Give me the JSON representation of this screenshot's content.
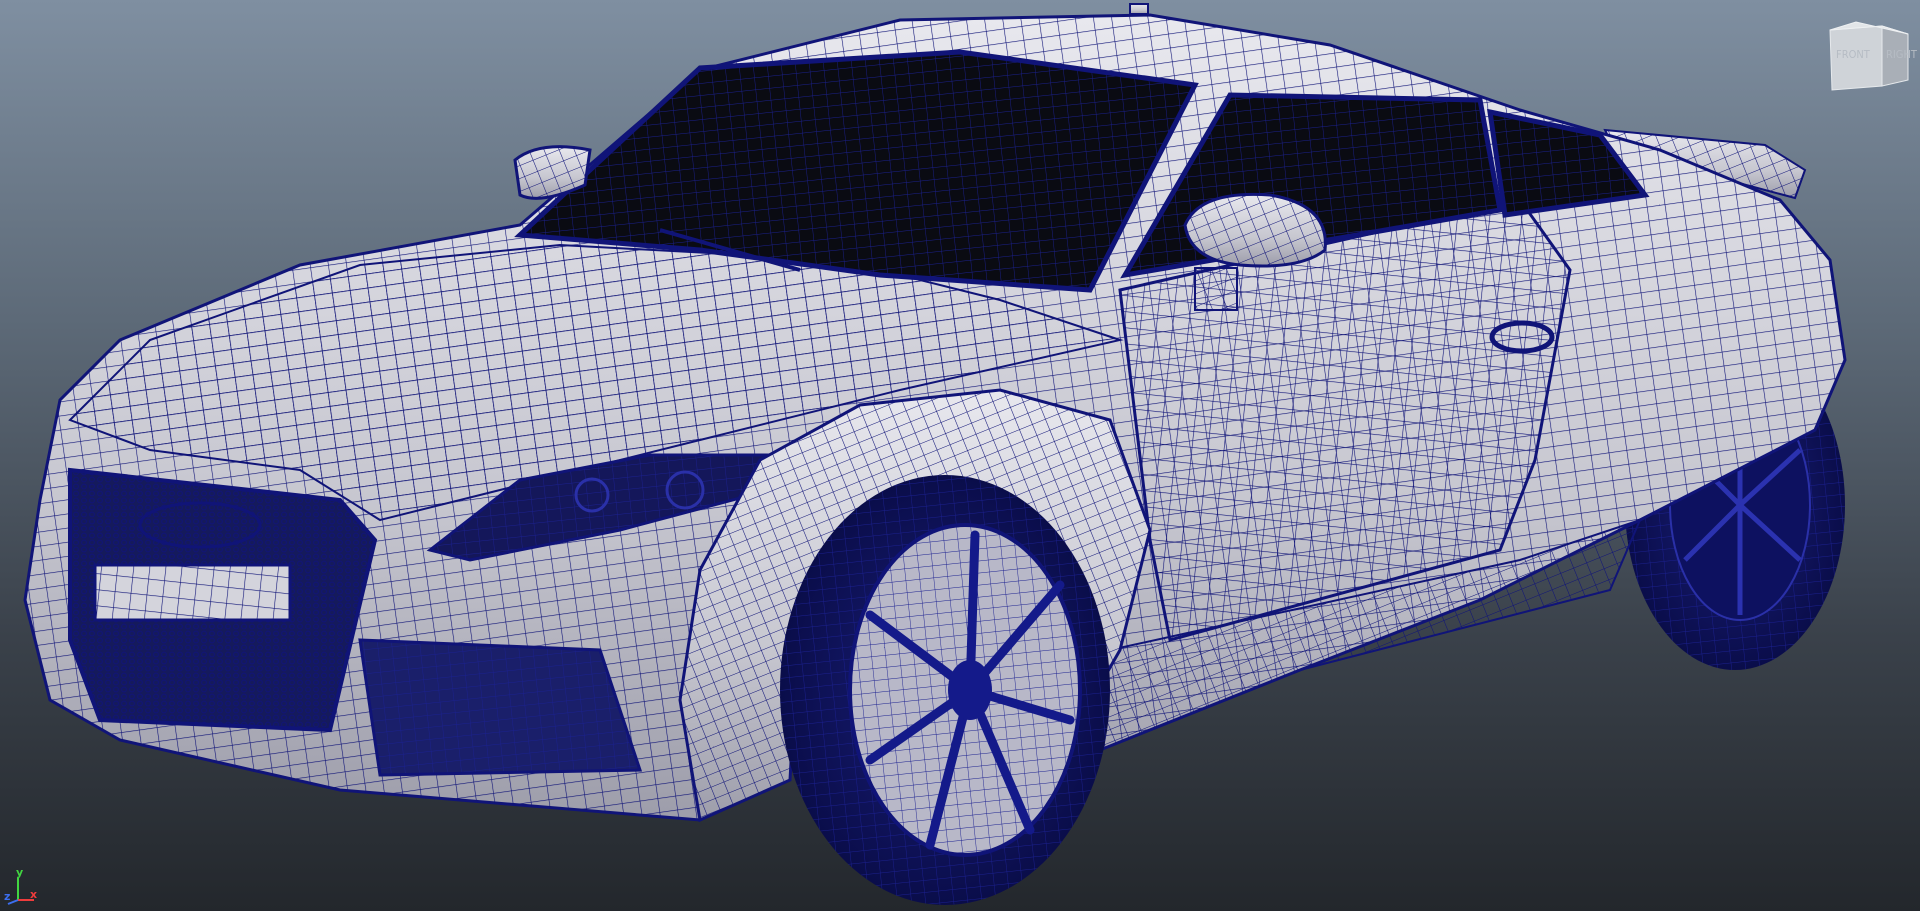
{
  "viewport": {
    "background_top": "#7f8fa1",
    "background_bottom": "#23272c",
    "wire_color": "#101478",
    "body_color": "#d9d9e2",
    "glass_color": "#0a0b12"
  },
  "viewcube": {
    "front_label": "FRONT",
    "right_label": "RIGHT"
  },
  "axis_gizmo": {
    "y_label": "y",
    "x_label": "x",
    "z_label": "z",
    "y_color": "#41d641",
    "x_color": "#ef3c3c",
    "z_color": "#3c6ff0"
  },
  "model": {
    "icons": [
      "car-wireframe-model"
    ]
  }
}
